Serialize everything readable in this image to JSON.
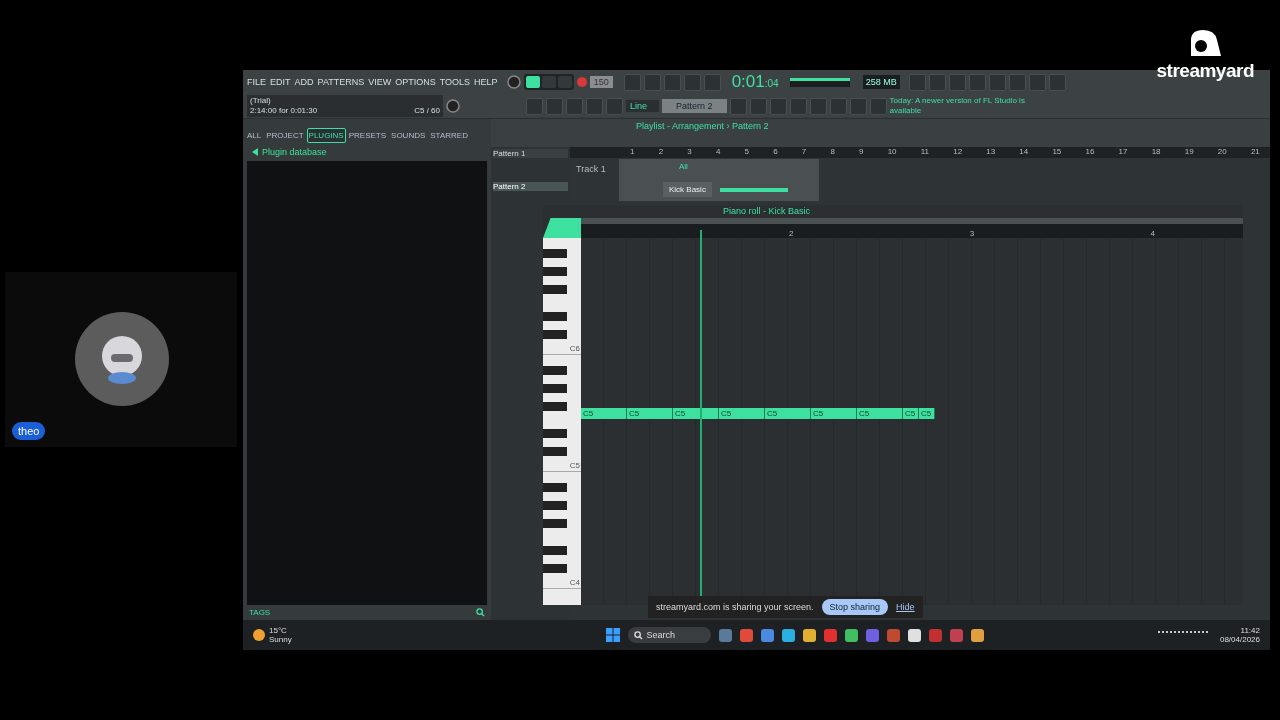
{
  "participant": {
    "name": "theo"
  },
  "logo": {
    "text": "streamyard"
  },
  "daw": {
    "menu": [
      "FILE",
      "EDIT",
      "ADD",
      "PATTERNS",
      "VIEW",
      "OPTIONS",
      "TOOLS",
      "HELP"
    ],
    "hint": {
      "title": "(Trial)",
      "line": "2:14:00 for 0:01:30",
      "note": "C5 / 60"
    },
    "tempo": "150",
    "time": "0:01",
    "time_small": ":04",
    "memory": "258 MB",
    "snap": "Line",
    "pattern": "Pattern 2",
    "news": "Today: A newer version of FL Studio is available",
    "browser": {
      "tabs": [
        {
          "label": "ALL",
          "selected": false
        },
        {
          "label": "PROJECT",
          "selected": false
        },
        {
          "label": "PLUGINS",
          "selected": true
        },
        {
          "label": "PRESETS",
          "selected": false
        },
        {
          "label": "SOUNDS",
          "selected": false
        },
        {
          "label": "STARRED",
          "selected": false
        }
      ],
      "folder": "Plugin database",
      "tags": "TAGS"
    },
    "playlist": {
      "title": "Playlist - Arrangement › Pattern 2",
      "patterns": [
        {
          "label": "Pattern 1",
          "selected": false
        },
        {
          "label": "Pattern 2",
          "selected": true
        }
      ],
      "track": "Track 1",
      "rack_filter": "All",
      "channel": "Kick Basic",
      "bars": [
        "1",
        "2",
        "3",
        "4",
        "5",
        "6",
        "7",
        "8",
        "9",
        "10",
        "11",
        "12",
        "13",
        "14",
        "15",
        "16",
        "17",
        "18",
        "19",
        "20",
        "21"
      ]
    },
    "piano_roll": {
      "title": "Piano roll - Kick Basic",
      "bars": [
        "2",
        "3",
        "4"
      ],
      "keys": [
        "C6",
        "C5",
        "C4"
      ],
      "notes": [
        {
          "label": "C5",
          "kind": "beat"
        },
        {
          "label": "C5",
          "kind": "beat"
        },
        {
          "label": "C5",
          "kind": "beat"
        },
        {
          "label": "C5",
          "kind": "beat"
        },
        {
          "label": "C5",
          "kind": "beat"
        },
        {
          "label": "C5",
          "kind": "beat"
        },
        {
          "label": "C5",
          "kind": "beat"
        },
        {
          "label": "C5",
          "kind": "short"
        },
        {
          "label": "C5",
          "kind": "short"
        }
      ]
    }
  },
  "share_bar": {
    "message": "streamyard.com is sharing your screen.",
    "stop": "Stop sharing",
    "hide": "Hide"
  },
  "taskbar": {
    "temperature": "15°C",
    "weather": "Sunny",
    "search": "Search",
    "time": "11:42",
    "date": "08/04/2026"
  }
}
